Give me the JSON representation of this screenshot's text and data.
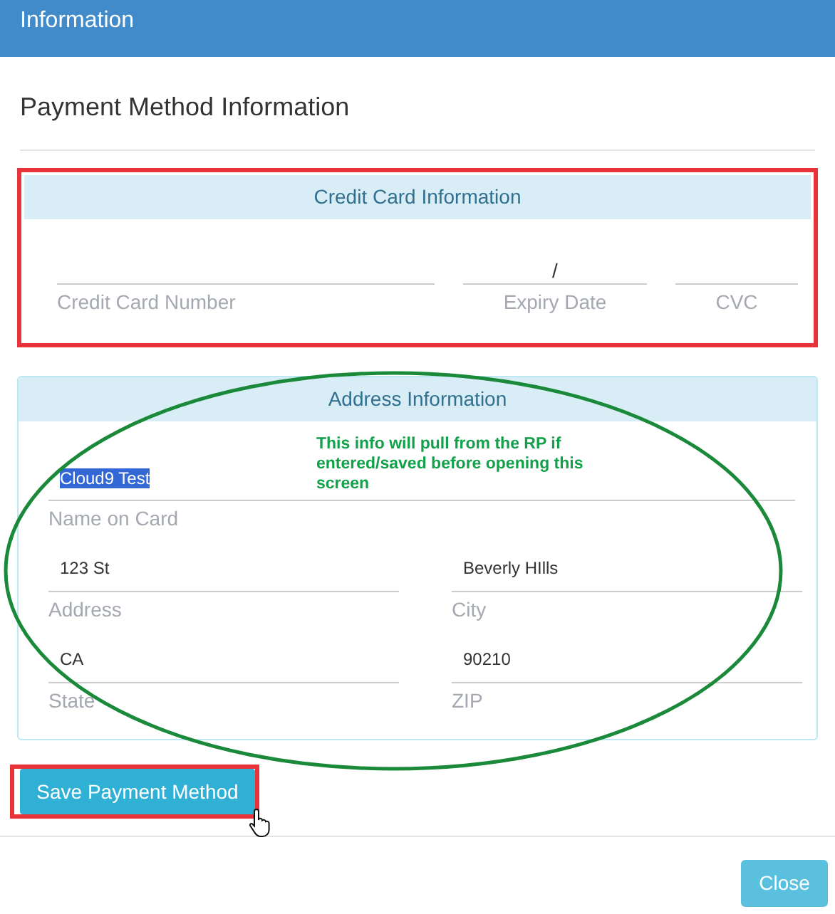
{
  "header": {
    "title": "Information"
  },
  "heading": "Payment Method Information",
  "credit_card_panel": {
    "title": "Credit Card Information",
    "highlighted": true,
    "fields": [
      {
        "label": "Credit Card Number"
      },
      {
        "label": "Expiry Date",
        "value": "/"
      },
      {
        "label": "CVC"
      }
    ]
  },
  "address_panel": {
    "title": "Address Information",
    "name_field": {
      "label": "Name on Card",
      "value": "Cloud9 Test",
      "text_selected": true
    },
    "fields": [
      {
        "label": "Address",
        "value": "123 St"
      },
      {
        "label": "City",
        "value": "Beverly HIlls"
      },
      {
        "label": "State",
        "value": "CA"
      },
      {
        "label": "ZIP",
        "value": "90210"
      }
    ]
  },
  "annotation": {
    "note": "This info will pull from the RP if entered/saved before opening this screen"
  },
  "save_button": {
    "label": "Save Payment Method",
    "highlighted": true
  },
  "footer": {
    "close_button": "Close"
  }
}
